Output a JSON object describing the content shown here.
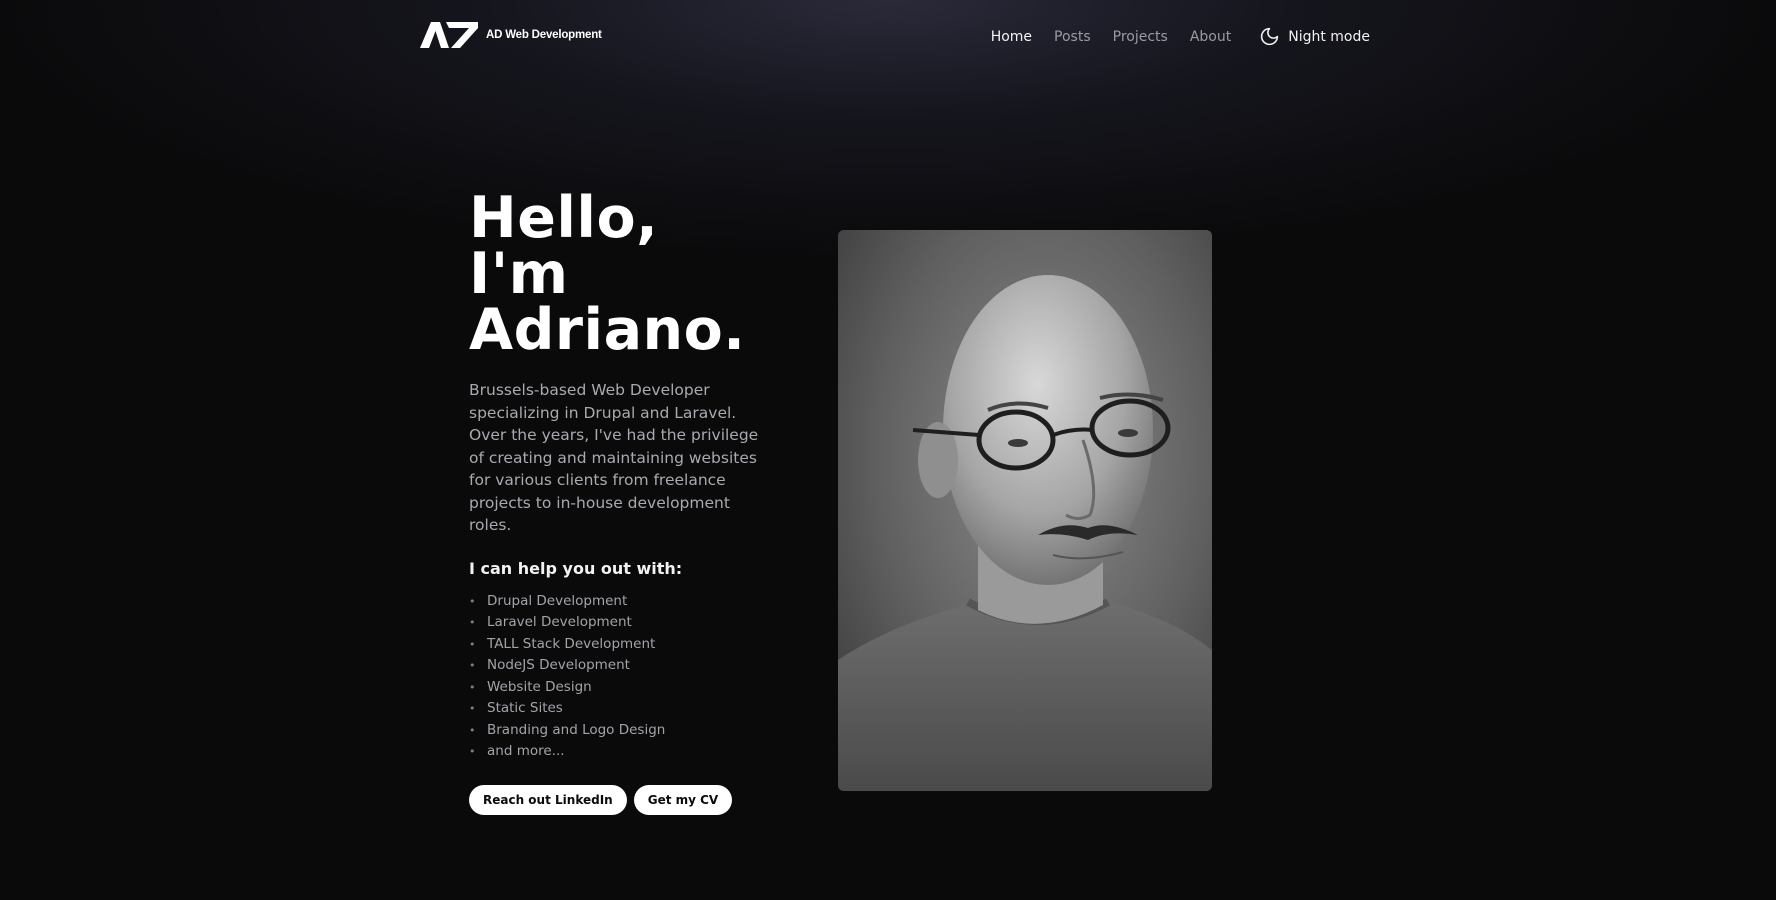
{
  "header": {
    "logo_text": "AD Web Development",
    "logo_icon": "ad-logo-mark",
    "nav": [
      {
        "label": "Home",
        "active": true
      },
      {
        "label": "Posts",
        "active": false
      },
      {
        "label": "Projects",
        "active": false
      },
      {
        "label": "About",
        "active": false
      }
    ],
    "night_mode": {
      "label": "Night mode",
      "icon": "moon-icon"
    }
  },
  "hero": {
    "title_lines": [
      "Hello,",
      "I'm",
      "Adriano."
    ],
    "intro": "Brussels-based Web Developer specializing in Drupal and Laravel. Over the years, I've had the privilege of creating and maintaining websites for various clients from freelance projects to in-house development roles.",
    "help_title": "I can help you out with:",
    "services": [
      "Drupal Development",
      "Laravel Development",
      "TALL Stack Development",
      "NodeJS Development",
      "Website Design",
      "Static Sites",
      "Branding and Logo Design",
      "and more..."
    ],
    "buttons": {
      "linkedin": "Reach out LinkedIn",
      "cv": "Get my CV"
    }
  },
  "colors": {
    "background": "#0a0a0b",
    "header_glow": "#2a2a3a",
    "text_primary": "#ffffff",
    "text_muted": "#a9a9b0",
    "button_bg": "#ffffff"
  }
}
